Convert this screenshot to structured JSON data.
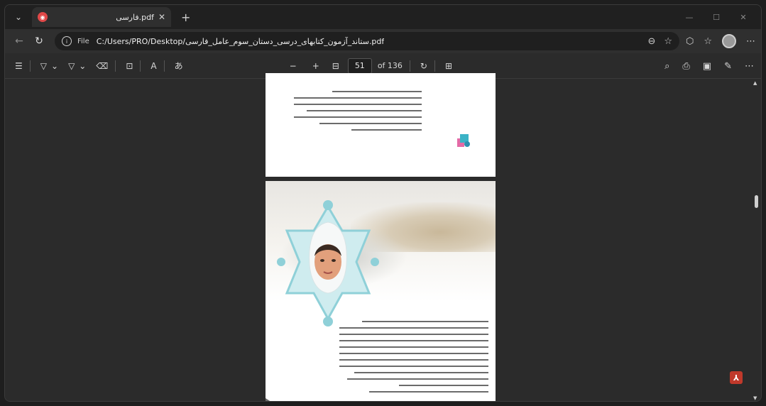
{
  "browser": {
    "tab_title": "فارسی.pdf",
    "window_controls": {
      "minimize": "—",
      "maximize": "☐",
      "close": "✕"
    },
    "url_scheme": "File",
    "url": "C:/Users/PRO/Desktop/ستاند_آزمون_کتابهای_درسی_دستان_سوم_عامل_فارسی.pdf"
  },
  "pdf_toolbar": {
    "current_page": "51",
    "page_count": "of 136"
  },
  "icons": {
    "tab_favicon": "pdf-icon",
    "back": "back-arrow-icon",
    "refresh": "refresh-icon",
    "zoom": "zoom-icon",
    "favorite": "star-icon",
    "extensions": "extensions-icon",
    "collections": "collections-icon",
    "profile": "avatar",
    "more": "more-icon",
    "acrobat": "acrobat-icon"
  },
  "colors": {
    "accent_red": "#e04848",
    "frame_teal": "#8fd0d8",
    "acrobat_red": "#c0392b"
  }
}
